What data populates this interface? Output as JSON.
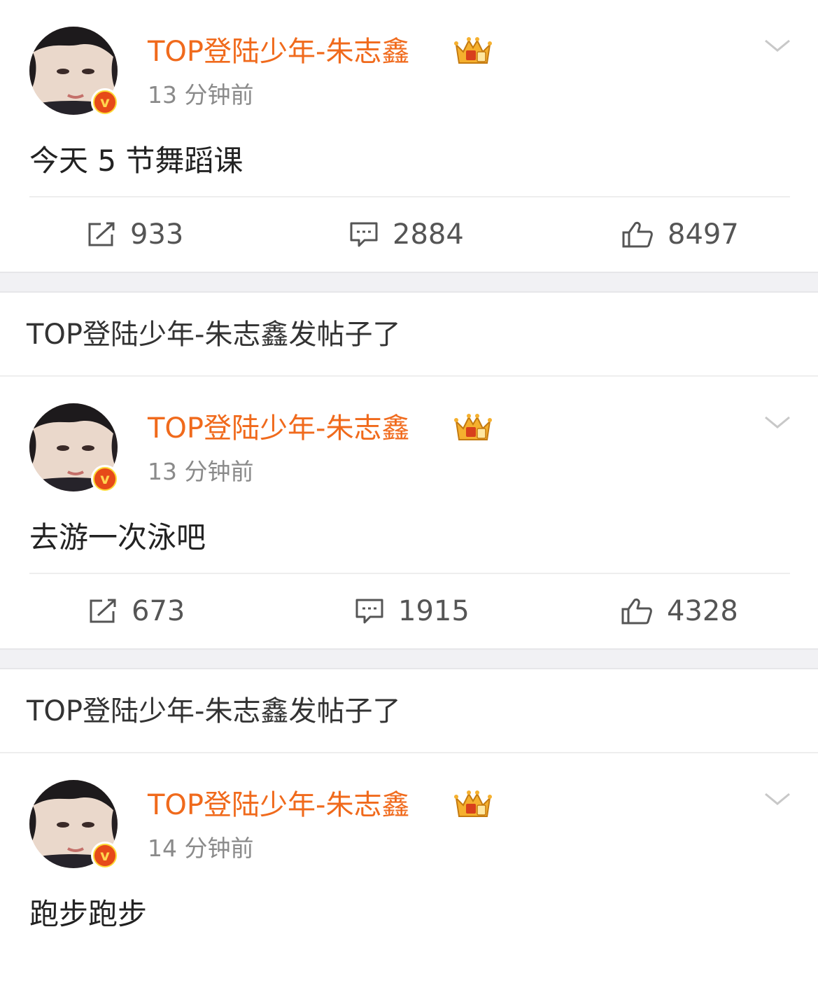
{
  "posts": [
    {
      "username": "TOP登陆少年-朱志鑫",
      "time": "13 分钟前",
      "text": "今天 5 节舞蹈课",
      "reposts": "933",
      "comments": "2884",
      "likes": "8497"
    },
    {
      "notice": "TOP登陆少年-朱志鑫发帖子了",
      "username": "TOP登陆少年-朱志鑫",
      "time": "13 分钟前",
      "text": "去游一次泳吧",
      "reposts": "673",
      "comments": "1915",
      "likes": "4328"
    },
    {
      "notice": "TOP登陆少年-朱志鑫发帖子了",
      "username": "TOP登陆少年-朱志鑫",
      "time": "14 分钟前",
      "text": "跑步跑步"
    }
  ],
  "icons": {
    "verified_badge": "v",
    "crown": "crown-icon",
    "menu": "chevron-down-icon",
    "repost": "repost-icon",
    "comment": "comment-icon",
    "like": "thumbs-up-icon"
  },
  "colors": {
    "username": "#f06a1c",
    "timestamp": "#8a8a8a",
    "separator": "#f1f1f4",
    "badge_outer": "#fdd835",
    "badge_inner": "#e64a19"
  }
}
